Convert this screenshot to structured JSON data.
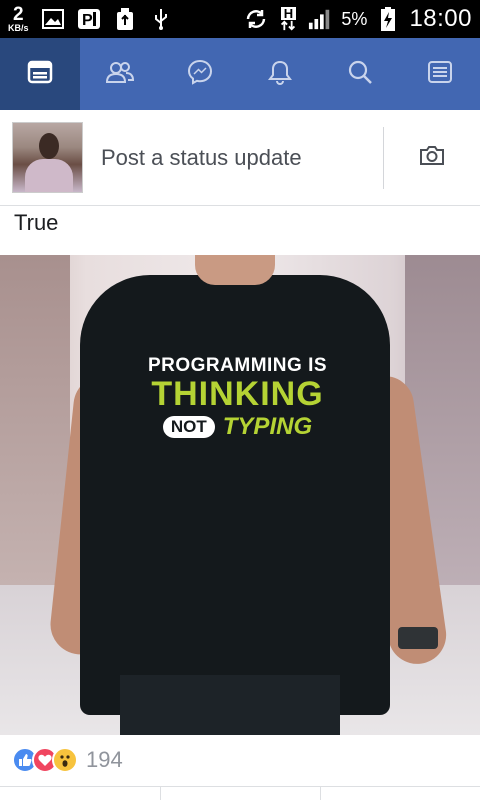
{
  "statusbar": {
    "speed_value": "2",
    "speed_unit": "KB/s",
    "network_type": "H",
    "battery_percent": "5%",
    "time": "18:00",
    "icons": [
      "image-icon",
      "parking-app-icon",
      "usb-storage-icon",
      "usb-icon",
      "sync-icon",
      "data-arrows-icon",
      "signal-icon",
      "battery-charging-icon"
    ]
  },
  "navbar": {
    "tabs": [
      {
        "icon": "news-feed-icon",
        "active": true
      },
      {
        "icon": "friends-icon",
        "active": false
      },
      {
        "icon": "messenger-icon",
        "active": false
      },
      {
        "icon": "notifications-icon",
        "active": false
      },
      {
        "icon": "search-icon",
        "active": false
      },
      {
        "icon": "menu-icon",
        "active": false
      }
    ],
    "color": "#4267b2",
    "active_color": "#29487d"
  },
  "composer": {
    "placeholder": "Post a status update",
    "camera_icon": "camera-icon"
  },
  "post": {
    "text": "True",
    "photo_print": {
      "line1": "PROGRAMMING IS",
      "line2": "THINKING",
      "line3a": "NOT",
      "line3b": "TYPING"
    },
    "reactions": [
      "like",
      "love",
      "wow"
    ],
    "reaction_count": "194"
  }
}
